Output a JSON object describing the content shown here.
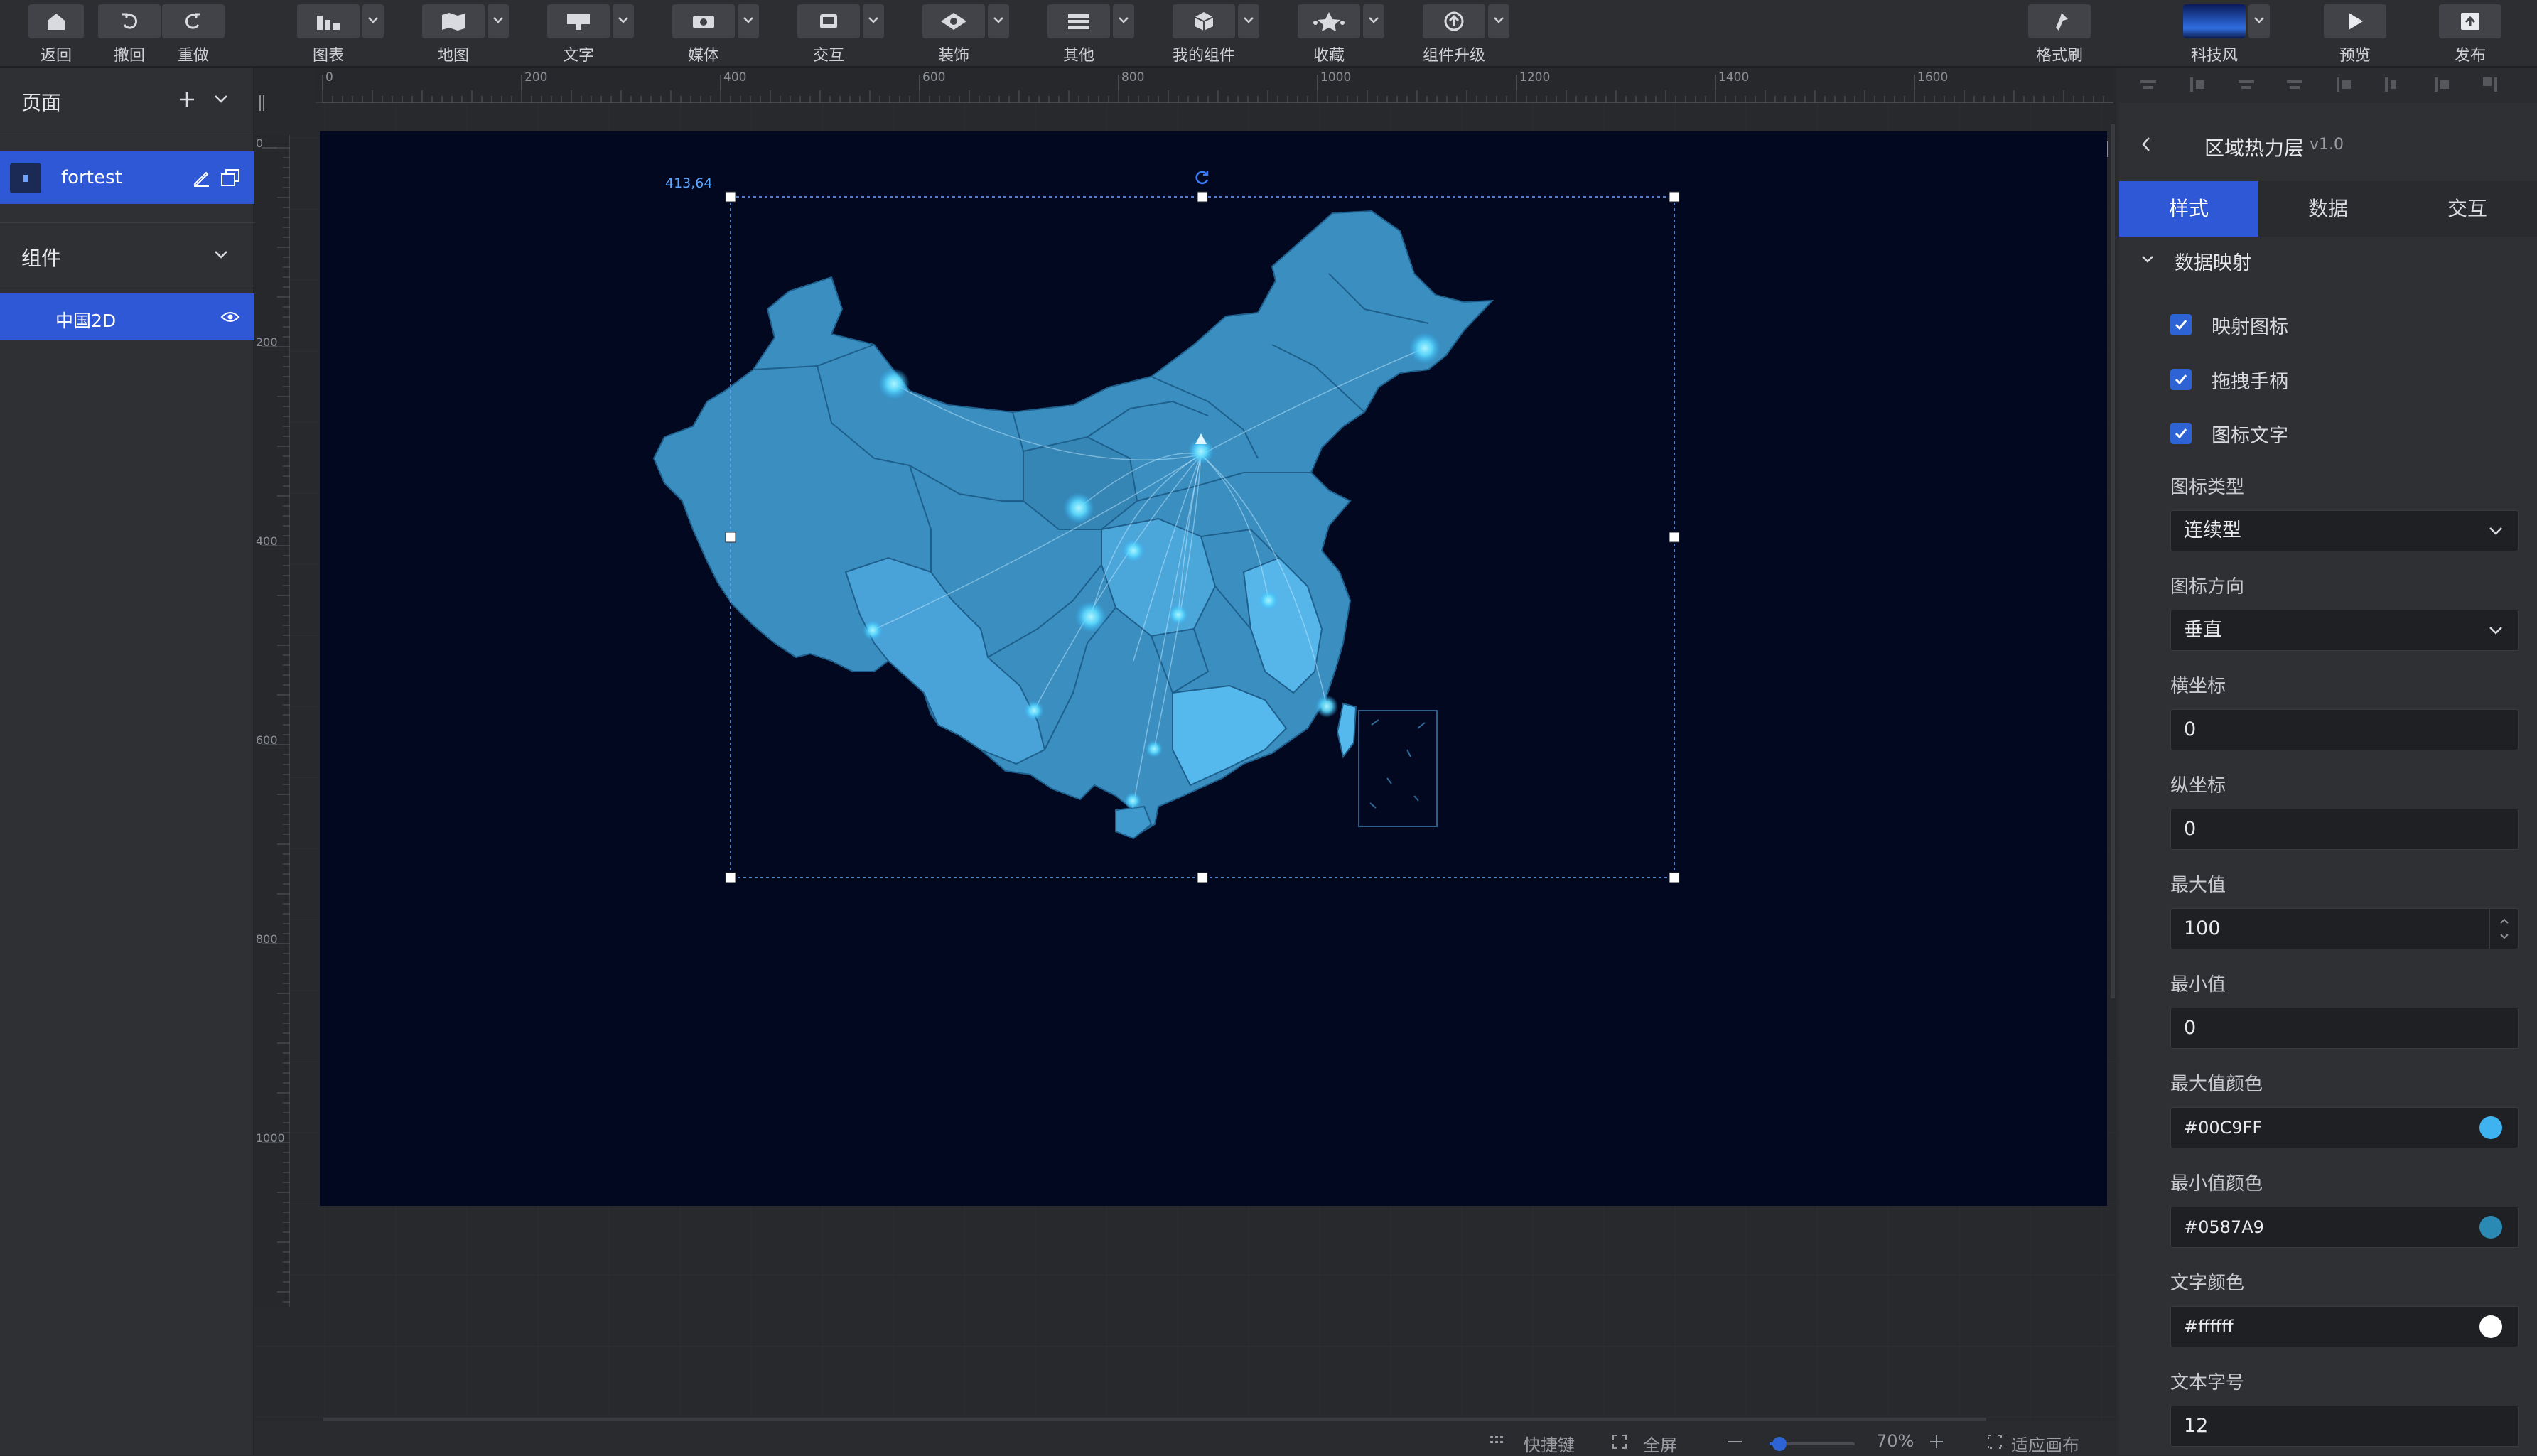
{
  "toolbar": {
    "back": "返回",
    "undo": "撤回",
    "redo": "重做",
    "chart": "图表",
    "map": "地图",
    "text": "文字",
    "media": "媒体",
    "interact": "交互",
    "decor": "装饰",
    "other": "其他",
    "mycomp": "我的组件",
    "favorite": "收藏",
    "upgrade": "组件升级",
    "format_brush": "格式刷",
    "theme": "科技风",
    "preview": "预览",
    "publish": "发布"
  },
  "left": {
    "pages_title": "页面",
    "page_name": "fortest",
    "components_title": "组件",
    "component_name": "中国2D"
  },
  "ruler": {
    "top": [
      "0",
      "200",
      "400",
      "600",
      "800",
      "1000",
      "1200",
      "1400",
      "1600"
    ],
    "left": [
      "0",
      "200",
      "400",
      "600",
      "800",
      "1000"
    ]
  },
  "canvas": {
    "coord": "413,64"
  },
  "right": {
    "title": "区域热力层",
    "version": "v1.0",
    "tabs": [
      "样式",
      "数据",
      "交互"
    ],
    "section": "数据映射",
    "checks": [
      "映射图标",
      "拖拽手柄",
      "图标文字"
    ],
    "icon_type_label": "图标类型",
    "icon_type": "连续型",
    "icon_dir_label": "图标方向",
    "icon_dir": "垂直",
    "x_label": "横坐标",
    "x_val": "0",
    "y_label": "纵坐标",
    "y_val": "0",
    "max_label": "最大值",
    "max_val": "100",
    "min_label": "最小值",
    "min_val": "0",
    "max_color_label": "最大值颜色",
    "max_color": "#00C9FF",
    "min_color_label": "最小值颜色",
    "min_color": "#0587A9",
    "text_color_label": "文字颜色",
    "text_color": "#ffffff",
    "font_size_label": "文本字号",
    "font_size": "12"
  },
  "status": {
    "shortcut": "快捷键",
    "fullscreen": "全屏",
    "zoom": "70%",
    "fit": "适应画布"
  },
  "colors": {
    "accent": "#2e58d6",
    "artboard": "#020820",
    "map_fill": "#3a8fc0",
    "map_light": "#4fb2e8"
  }
}
